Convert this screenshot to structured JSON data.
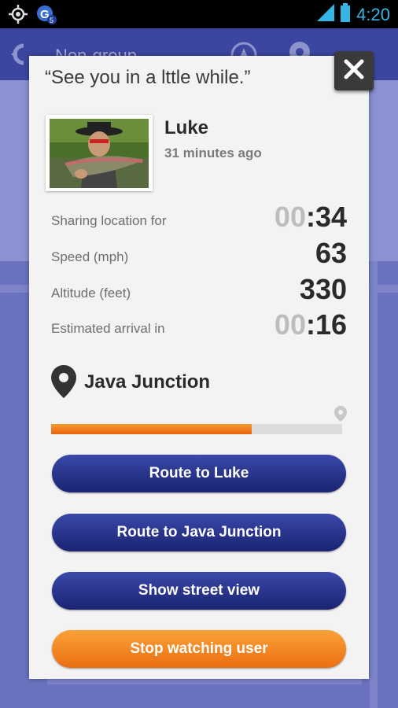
{
  "status_bar": {
    "time": "4:20",
    "icons": [
      "gps-icon",
      "notification-g-icon",
      "signal-icon",
      "battery-icon",
      "overflow-dots-icon"
    ]
  },
  "background": {
    "toolbar_title": "Non-group"
  },
  "dialog": {
    "quote": "“See you in a lttle while.”",
    "user": {
      "name": "Luke",
      "last_seen": "31 minutes ago"
    },
    "stats": [
      {
        "label": "Sharing location for",
        "value_dim": "00",
        "value_main": ":34"
      },
      {
        "label": "Speed (mph)",
        "value_dim": "",
        "value_main": "63"
      },
      {
        "label": "Altitude (feet)",
        "value_dim": "",
        "value_main": "330"
      },
      {
        "label": "Estimated arrival in",
        "value_dim": "00",
        "value_main": ":16"
      }
    ],
    "destination": {
      "name": "Java Junction",
      "progress_fraction": 0.69
    },
    "buttons": {
      "route_user": "Route to Luke",
      "route_destination": "Route to Java Junction",
      "street_view": "Show street view",
      "stop_watching": "Stop watching user"
    },
    "colors": {
      "primary_button": "#26318a",
      "stop_button": "#f2831f",
      "progress": "#f07a1a"
    }
  }
}
